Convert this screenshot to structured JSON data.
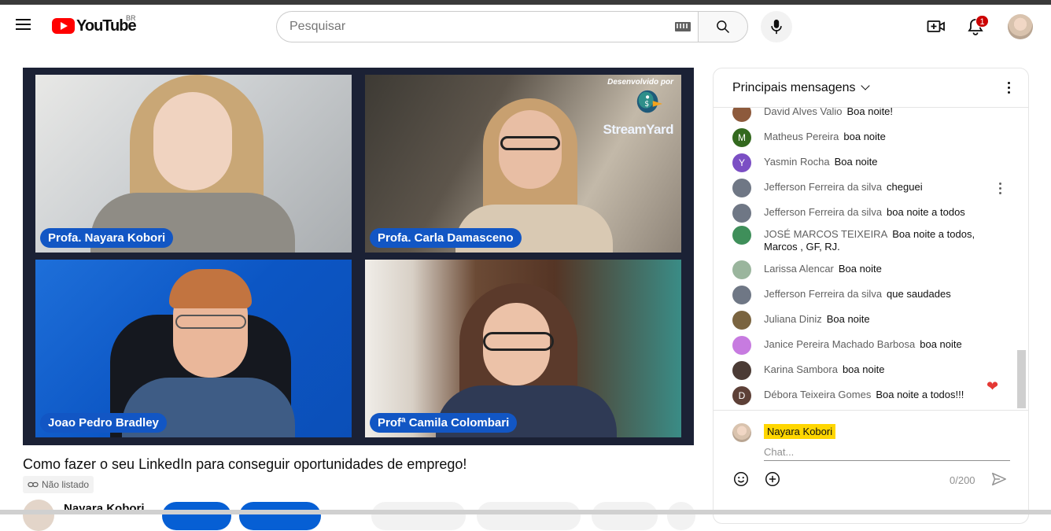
{
  "masthead": {
    "logo_text": "YouTube",
    "country_code": "BR",
    "search_placeholder": "Pesquisar",
    "notification_count": "1"
  },
  "video": {
    "title": "Como fazer o seu LinkedIn para conseguir oportunidades de emprego!",
    "visibility": "Não listado",
    "owner": "Nayara Kobori",
    "participants": [
      "Profa. Nayara Kobori",
      "Profa. Carla Damasceno",
      "Joao Pedro Bradley",
      "Profª Camila Colombari"
    ],
    "watermark_small": "Desenvolvido por",
    "watermark_brand": "StreamYard"
  },
  "chat": {
    "header_title": "Principais mensagens",
    "messages": [
      {
        "author": "David Alves Valio",
        "text": "Boa noite!",
        "avatar_color": "#8d5a3c",
        "initial": ""
      },
      {
        "author": "Matheus Pereira",
        "text": "boa noite",
        "avatar_color": "#33691e",
        "initial": "M"
      },
      {
        "author": "Yasmin Rocha",
        "text": "Boa noite",
        "avatar_color": "#7b4fc4",
        "initial": "Y"
      },
      {
        "author": "Jefferson Ferreira da silva",
        "text": "cheguei",
        "avatar_color": "#6f7785",
        "initial": ""
      },
      {
        "author": "Jefferson Ferreira da silva",
        "text": "boa noite a todos",
        "avatar_color": "#6f7785",
        "initial": ""
      },
      {
        "author": "JOSÉ MARCOS TEIXEIRA",
        "text": "Boa noite a todos, Marcos , GF, RJ.",
        "avatar_color": "#3f8f5a",
        "initial": ""
      },
      {
        "author": "Larissa Alencar",
        "text": "Boa noite",
        "avatar_color": "#9ab59d",
        "initial": ""
      },
      {
        "author": "Jefferson Ferreira da silva",
        "text": "que saudades",
        "avatar_color": "#6f7785",
        "initial": ""
      },
      {
        "author": "Juliana Diniz",
        "text": "Boa noite",
        "avatar_color": "#7a6440",
        "initial": ""
      },
      {
        "author": "Janice Pereira Machado Barbosa",
        "text": "boa noite",
        "avatar_color": "#c77be0",
        "initial": ""
      },
      {
        "author": "Karina Sambora",
        "text": "boa noite",
        "avatar_color": "#4b3b35",
        "initial": ""
      },
      {
        "author": "Débora Teixeira Gomes",
        "text": "Boa noite a todos!!!",
        "avatar_color": "#5d4037",
        "initial": "D"
      }
    ],
    "current_user": "Nayara Kobori",
    "input_placeholder": "Chat...",
    "char_counter": "0/200",
    "reaction": "❤"
  }
}
